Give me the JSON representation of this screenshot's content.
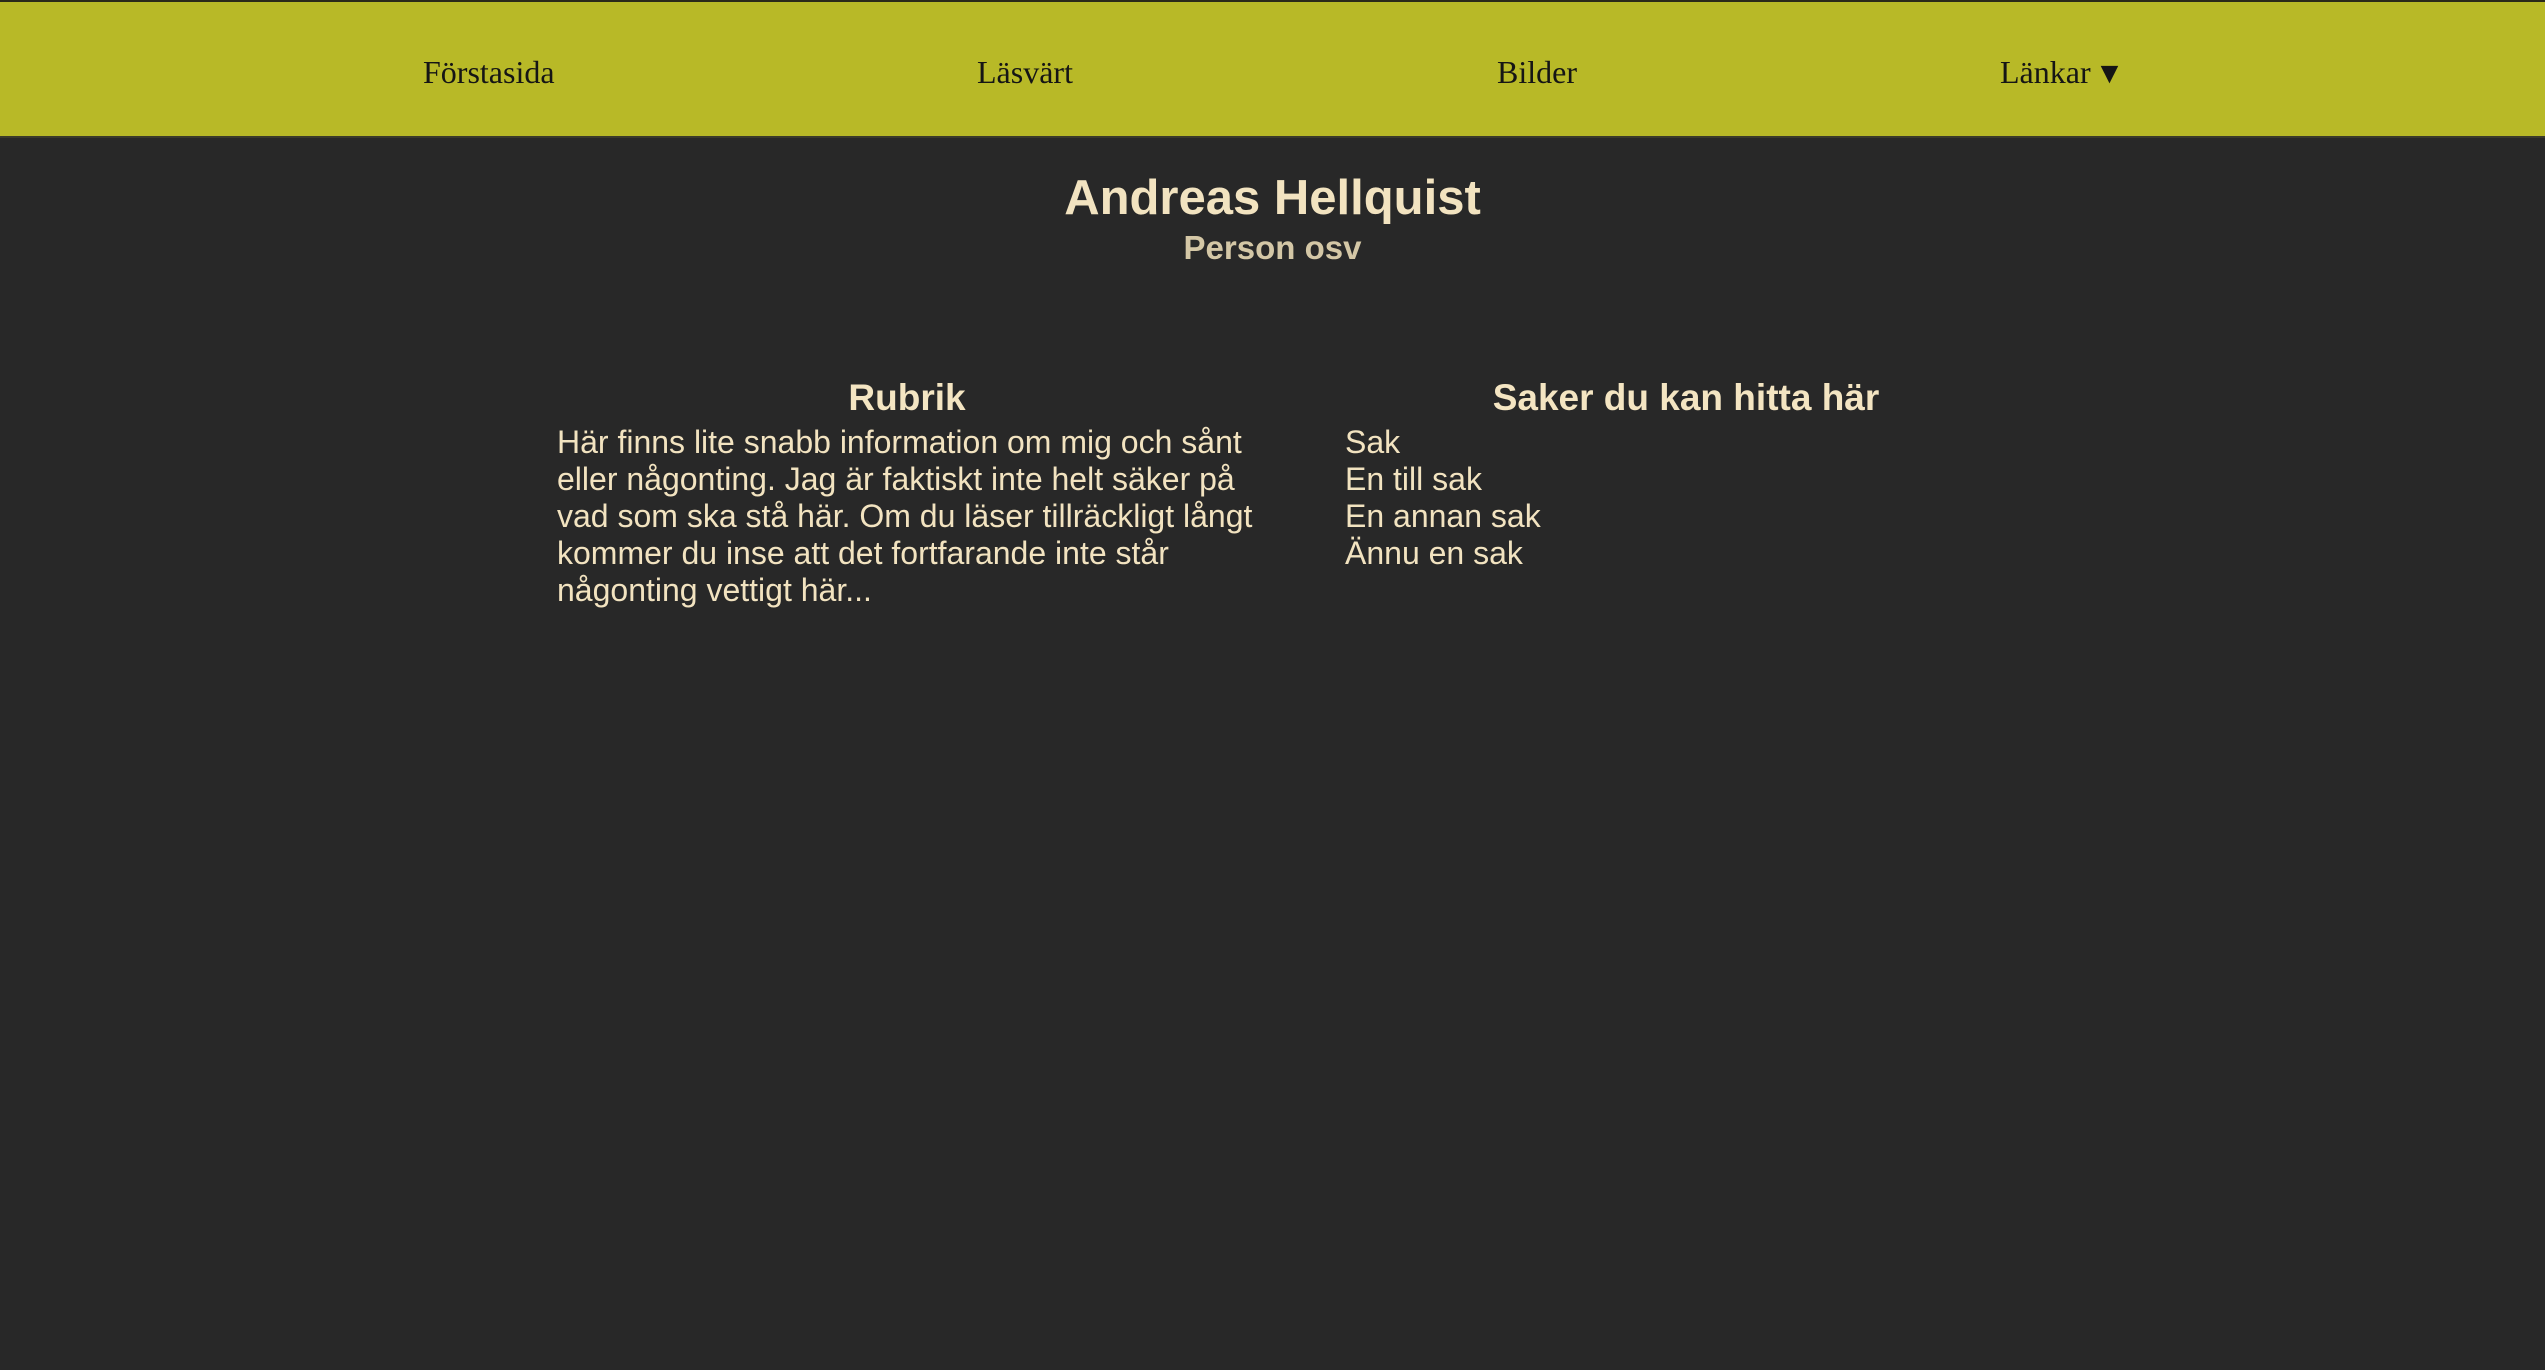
{
  "nav": {
    "items": [
      {
        "label": "Förstasida"
      },
      {
        "label": "Läsvärt"
      },
      {
        "label": "Bilder"
      },
      {
        "label": "Länkar",
        "caret": "▼"
      }
    ]
  },
  "header": {
    "title": "Andreas Hellquist",
    "subtitle": "Person osv"
  },
  "main": {
    "left": {
      "heading": "Rubrik",
      "text": "Här finns lite snabb information om mig och sånt eller någonting. Jag är faktiskt inte helt säker på vad som ska stå här. Om du läser tillräckligt långt kommer du inse att det fortfarande inte står någonting vettigt här..."
    },
    "right": {
      "heading": "Saker du kan hitta här",
      "items": [
        "Sak",
        "En till sak",
        "En annan sak",
        "Ännu en sak"
      ]
    }
  },
  "colors": {
    "navbar_bg": "#b8b927",
    "page_bg": "#282828",
    "text": "#f2e3c0"
  },
  "icons": {
    "dropdown": "chevron-down-icon"
  }
}
